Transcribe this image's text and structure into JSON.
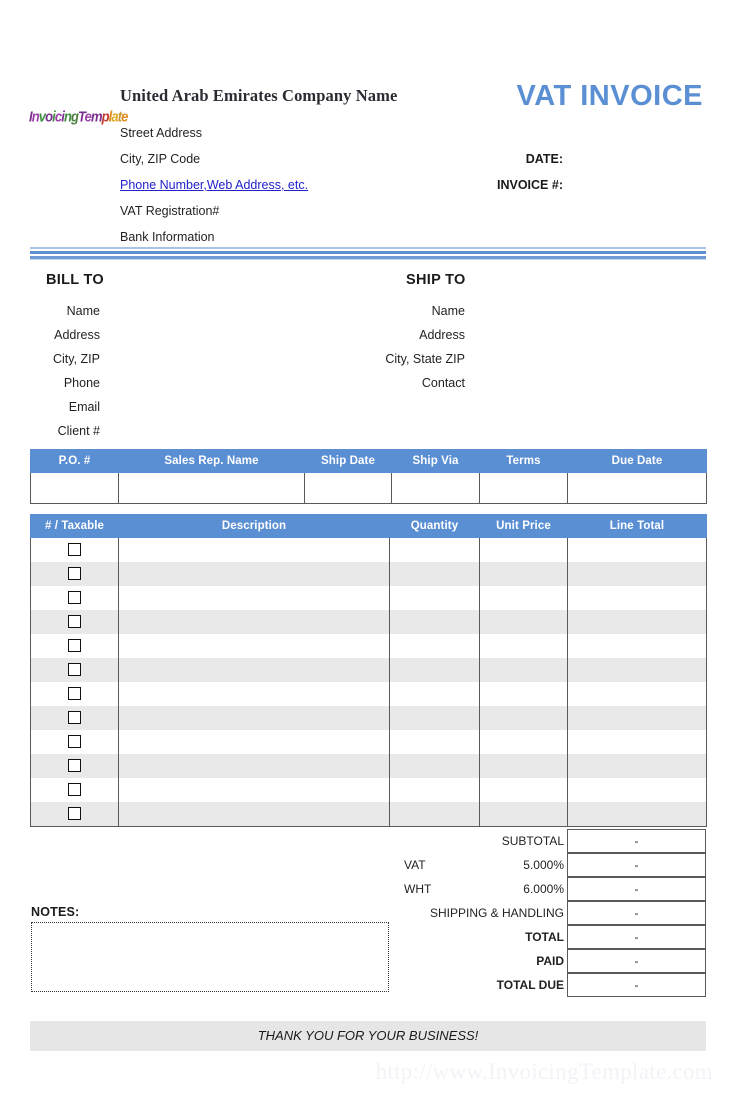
{
  "document": {
    "title": "VAT INVOICE",
    "accent_blue": "#5b8fd4",
    "logo_text_parts": [
      {
        "t": "I",
        "c": "#7b2f8f"
      },
      {
        "t": "n",
        "c": "#9b3fa8"
      },
      {
        "t": "v",
        "c": "#3f8f3f"
      },
      {
        "t": "o",
        "c": "#7b2f8f"
      },
      {
        "t": "i",
        "c": "#3f8f3f"
      },
      {
        "t": "c",
        "c": "#9b3fa8"
      },
      {
        "t": "i",
        "c": "#7b2f8f"
      },
      {
        "t": "n",
        "c": "#3f8f3f"
      },
      {
        "t": "g",
        "c": "#4f7f3f"
      },
      {
        "t": "T",
        "c": "#7b2f8f"
      },
      {
        "t": "e",
        "c": "#9b3fa8"
      },
      {
        "t": "m",
        "c": "#7b2f8f"
      },
      {
        "t": "p",
        "c": "#c0392b"
      },
      {
        "t": "l",
        "c": "#e08a1e"
      },
      {
        "t": "a",
        "c": "#e0a81e"
      },
      {
        "t": "t",
        "c": "#c99a2e"
      },
      {
        "t": "e",
        "c": "#e08a1e"
      }
    ]
  },
  "company": {
    "name": "United Arab Emirates Company Name",
    "lines": [
      "Street Address",
      "City,  ZIP Code",
      "Phone Number,Web Address, etc.",
      "VAT Registration#",
      "Bank Information"
    ]
  },
  "meta": {
    "date_label": "DATE:",
    "invoice_label": "INVOICE #:",
    "date_value": "",
    "invoice_value": ""
  },
  "bill_to": {
    "heading": "BILL TO",
    "fields": [
      "Name",
      "Address",
      "City, ZIP",
      "Phone",
      "Email",
      "Client #"
    ]
  },
  "ship_to": {
    "heading": "SHIP TO",
    "fields": [
      "Name",
      "Address",
      "City, State ZIP",
      "Contact"
    ]
  },
  "po_table": {
    "headers": [
      "P.O. #",
      "Sales Rep. Name",
      "Ship Date",
      "Ship Via",
      "Terms",
      "Due Date"
    ],
    "row": [
      "",
      "",
      "",
      "",
      "",
      ""
    ]
  },
  "items_table": {
    "headers": [
      "# / Taxable",
      "Description",
      "Quantity",
      "Unit Price",
      "Line Total"
    ],
    "row_count": 12,
    "rows": [
      {
        "taxable": false,
        "description": "",
        "quantity": "",
        "unit_price": "",
        "line_total": ""
      },
      {
        "taxable": false,
        "description": "",
        "quantity": "",
        "unit_price": "",
        "line_total": ""
      },
      {
        "taxable": false,
        "description": "",
        "quantity": "",
        "unit_price": "",
        "line_total": ""
      },
      {
        "taxable": false,
        "description": "",
        "quantity": "",
        "unit_price": "",
        "line_total": ""
      },
      {
        "taxable": false,
        "description": "",
        "quantity": "",
        "unit_price": "",
        "line_total": ""
      },
      {
        "taxable": false,
        "description": "",
        "quantity": "",
        "unit_price": "",
        "line_total": ""
      },
      {
        "taxable": false,
        "description": "",
        "quantity": "",
        "unit_price": "",
        "line_total": ""
      },
      {
        "taxable": false,
        "description": "",
        "quantity": "",
        "unit_price": "",
        "line_total": ""
      },
      {
        "taxable": false,
        "description": "",
        "quantity": "",
        "unit_price": "",
        "line_total": ""
      },
      {
        "taxable": false,
        "description": "",
        "quantity": "",
        "unit_price": "",
        "line_total": ""
      },
      {
        "taxable": false,
        "description": "",
        "quantity": "",
        "unit_price": "",
        "line_total": ""
      },
      {
        "taxable": false,
        "description": "",
        "quantity": "",
        "unit_price": "",
        "line_total": ""
      }
    ]
  },
  "totals": [
    {
      "label": "SUBTOTAL",
      "rate": "",
      "value": "-",
      "bold": false
    },
    {
      "label": "VAT",
      "rate": "5.000%",
      "value": "-",
      "bold": false
    },
    {
      "label": "WHT",
      "rate": "6.000%",
      "value": "-",
      "bold": false
    },
    {
      "label": "SHIPPING & HANDLING",
      "rate": "",
      "value": "-",
      "bold": false
    },
    {
      "label": "TOTAL",
      "rate": "",
      "value": "-",
      "bold": true
    },
    {
      "label": "PAID",
      "rate": "",
      "value": "-",
      "bold": true
    },
    {
      "label": "TOTAL DUE",
      "rate": "",
      "value": "-",
      "bold": true
    }
  ],
  "notes": {
    "label": "NOTES:",
    "value": ""
  },
  "footer": {
    "message": "THANK YOU FOR YOUR BUSINESS!",
    "watermark": "http://www.InvoicingTemplate.com"
  }
}
